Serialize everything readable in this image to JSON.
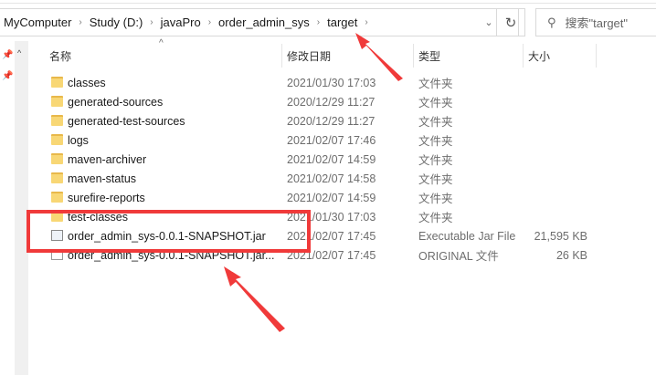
{
  "breadcrumb": [
    "MyComputer",
    "Study (D:)",
    "javaPro",
    "order_admin_sys",
    "target"
  ],
  "search": {
    "placeholder": "搜索\"target\""
  },
  "columns": {
    "name": "名称",
    "date": "修改日期",
    "type": "类型",
    "size": "大小"
  },
  "files": [
    {
      "name": "classes",
      "date": "2021/01/30 17:03",
      "type": "文件夹",
      "size": "",
      "icon": "folder"
    },
    {
      "name": "generated-sources",
      "date": "2020/12/29 11:27",
      "type": "文件夹",
      "size": "",
      "icon": "folder"
    },
    {
      "name": "generated-test-sources",
      "date": "2020/12/29 11:27",
      "type": "文件夹",
      "size": "",
      "icon": "folder"
    },
    {
      "name": "logs",
      "date": "2021/02/07 17:46",
      "type": "文件夹",
      "size": "",
      "icon": "folder"
    },
    {
      "name": "maven-archiver",
      "date": "2021/02/07 14:59",
      "type": "文件夹",
      "size": "",
      "icon": "folder"
    },
    {
      "name": "maven-status",
      "date": "2021/02/07 14:58",
      "type": "文件夹",
      "size": "",
      "icon": "folder"
    },
    {
      "name": "surefire-reports",
      "date": "2021/02/07 14:59",
      "type": "文件夹",
      "size": "",
      "icon": "folder"
    },
    {
      "name": "test-classes",
      "date": "2021/01/30 17:03",
      "type": "文件夹",
      "size": "",
      "icon": "folder"
    },
    {
      "name": "order_admin_sys-0.0.1-SNAPSHOT.jar",
      "date": "2021/02/07 17:45",
      "type": "Executable Jar File",
      "size": "21,595 KB",
      "icon": "jar"
    },
    {
      "name": "order_admin_sys-0.0.1-SNAPSHOT.jar...",
      "date": "2021/02/07 17:45",
      "type": "ORIGINAL 文件",
      "size": "26 KB",
      "icon": "file"
    }
  ],
  "annotation_color": "#f03a3a"
}
